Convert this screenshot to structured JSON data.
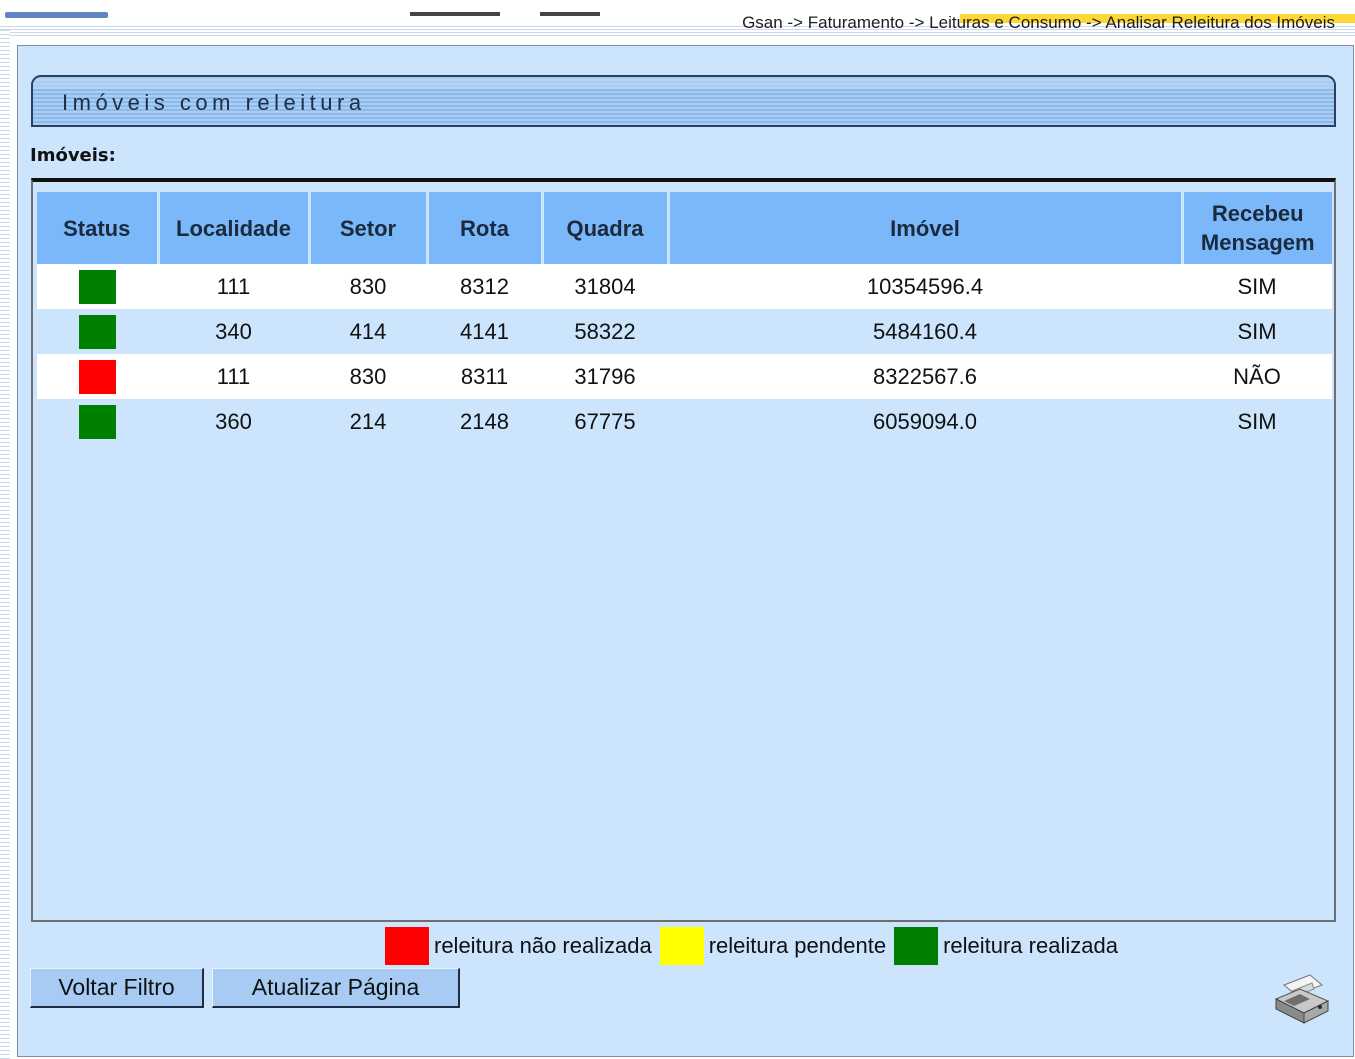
{
  "breadcrumb": "Gsan -> Faturamento -> Leituras e Consumo -> Analisar Releitura dos Imóveis",
  "section_title": "Imóveis com releitura",
  "list_label": "Imóveis:",
  "table": {
    "headers": [
      "Status",
      "Localidade",
      "Setor",
      "Rota",
      "Quadra",
      "Imóvel",
      "Recebeu Mensagem"
    ],
    "rows": [
      {
        "status": "realizada",
        "status_color": "#008000",
        "localidade": "111",
        "setor": "830",
        "rota": "8312",
        "quadra": "31804",
        "imovel": "10354596.4",
        "recebeu": "SIM"
      },
      {
        "status": "realizada",
        "status_color": "#008000",
        "localidade": "340",
        "setor": "414",
        "rota": "4141",
        "quadra": "58322",
        "imovel": "5484160.4",
        "recebeu": "SIM"
      },
      {
        "status": "nao_realizada",
        "status_color": "#ff0000",
        "localidade": "111",
        "setor": "830",
        "rota": "8311",
        "quadra": "31796",
        "imovel": "8322567.6",
        "recebeu": "NÃO"
      },
      {
        "status": "realizada",
        "status_color": "#008000",
        "localidade": "360",
        "setor": "214",
        "rota": "2148",
        "quadra": "67775",
        "imovel": "6059094.0",
        "recebeu": "SIM"
      }
    ]
  },
  "legend": [
    {
      "label": "releitura não realizada",
      "color": "#ff0000"
    },
    {
      "label": "releitura pendente",
      "color": "#ffff00"
    },
    {
      "label": "releitura realizada",
      "color": "#008000"
    }
  ],
  "buttons": {
    "voltar": "Voltar Filtro",
    "atualizar": "Atualizar Página"
  },
  "icons": {
    "print": "printer-icon"
  }
}
